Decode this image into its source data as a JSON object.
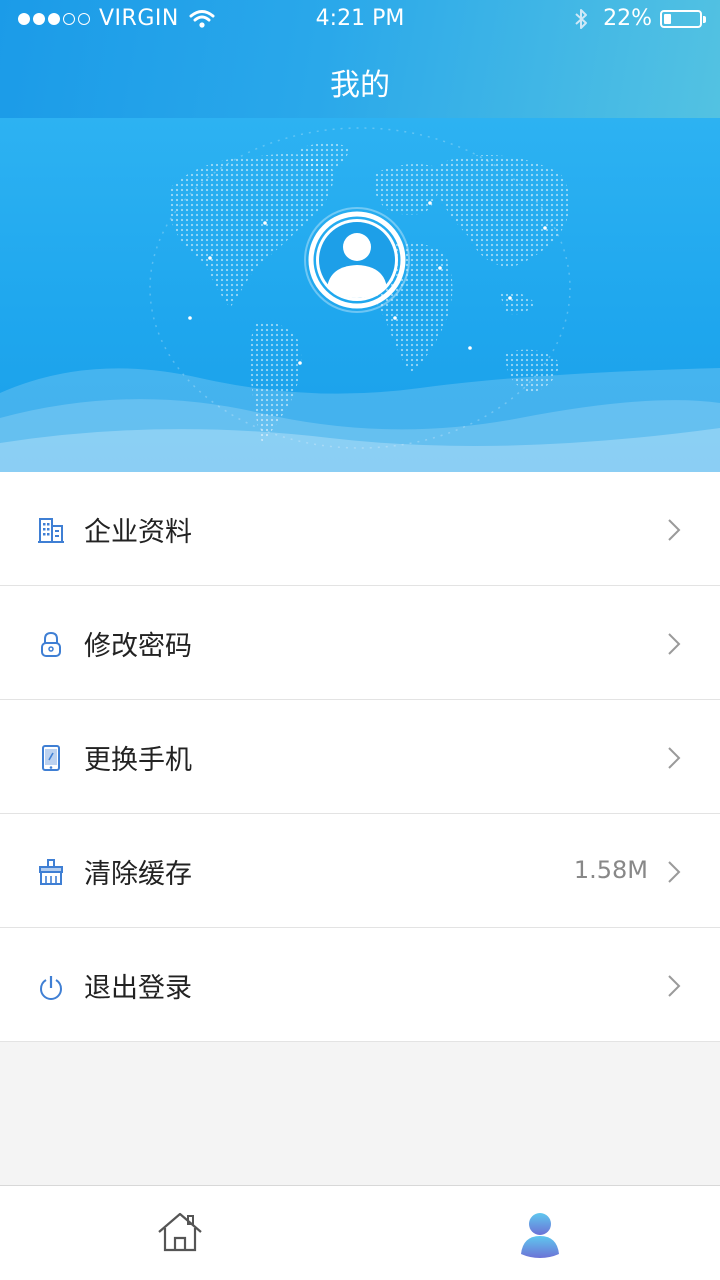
{
  "status_bar": {
    "signal_dots_filled": 3,
    "signal_dots_total": 5,
    "carrier": "VIRGIN",
    "time": "4:21 PM",
    "battery_percent": "22%",
    "battery_level": 0.22
  },
  "header": {
    "title": "我的"
  },
  "menu": {
    "items": [
      {
        "label": "企业资料",
        "icon": "building-icon",
        "value": ""
      },
      {
        "label": "修改密码",
        "icon": "lock-icon",
        "value": ""
      },
      {
        "label": "更换手机",
        "icon": "phone-icon",
        "value": ""
      },
      {
        "label": "清除缓存",
        "icon": "broom-icon",
        "value": "1.58M"
      },
      {
        "label": "退出登录",
        "icon": "power-icon",
        "value": ""
      }
    ]
  },
  "tabbar": {
    "tabs": [
      {
        "icon": "home-icon",
        "active": false
      },
      {
        "icon": "user-icon",
        "active": true
      }
    ]
  },
  "colors": {
    "accent": "#1b9be8",
    "accent_light": "#53c2e2",
    "icon_blue": "#3f7fd4",
    "text": "#222222",
    "muted": "#888888",
    "background": "#f4f4f4"
  }
}
